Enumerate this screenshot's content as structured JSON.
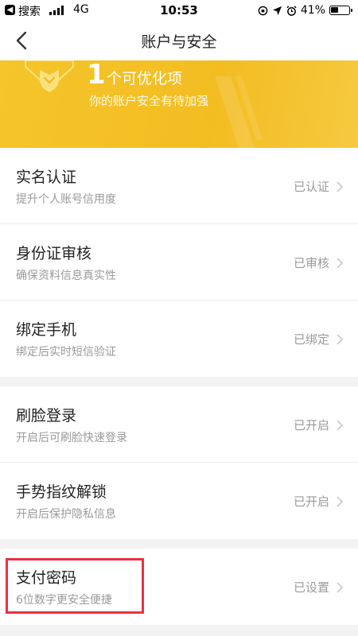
{
  "status_bar": {
    "back_glyph": "◀",
    "app": "搜索",
    "network": "4G",
    "time": "10:53",
    "battery": "41%",
    "battery_level": 0.41
  },
  "nav": {
    "title": "账户与安全",
    "back_icon": "chevron-left-icon"
  },
  "banner": {
    "count": "1",
    "count_label": "个可优化项",
    "subtitle": "你的账户安全有待加强",
    "colors": {
      "background": "#f3bd22",
      "text": "#ffffff"
    }
  },
  "groups": [
    {
      "items": [
        {
          "title": "实名认证",
          "subtitle": "提升个人账号信用度",
          "status": "已认证"
        },
        {
          "title": "身份证审核",
          "subtitle": "确保资料信息真实性",
          "status": "已审核"
        },
        {
          "title": "绑定手机",
          "subtitle": "绑定后实时短信验证",
          "status": "已绑定"
        }
      ]
    },
    {
      "items": [
        {
          "title": "刷脸登录",
          "subtitle": "开启后可刷脸快速登录",
          "status": "已开启"
        },
        {
          "title": "手势指纹解锁",
          "subtitle": "开启后保护隐私信息",
          "status": "已开启"
        }
      ]
    },
    {
      "items": [
        {
          "title": "支付密码",
          "subtitle": "6位数字更安全便捷",
          "status": "已设置"
        }
      ]
    }
  ],
  "colors": {
    "highlight_box": "#ee2e43",
    "secondary_text": "#9a9a9a"
  }
}
